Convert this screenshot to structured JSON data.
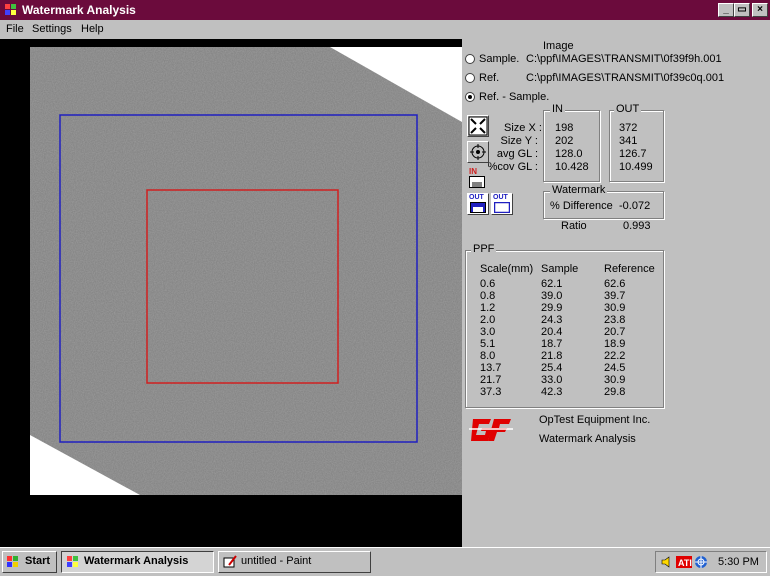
{
  "window": {
    "title": "Watermark Analysis",
    "title_bar_color": "#6b0b3c",
    "minimize_glyph": "_",
    "maximize_glyph": "▭",
    "close_glyph": "×"
  },
  "menu": {
    "file": "File",
    "settings": "Settings",
    "help": "Help"
  },
  "image_source": {
    "header": "Image",
    "sample_label": "Sample.",
    "sample_path": "C:\\ppf\\IMAGES\\TRANSMIT\\0f39f9h.001",
    "ref_label": "Ref.",
    "ref_path": "C:\\ppf\\IMAGES\\TRANSMIT\\0f39c0q.001",
    "ref_minus_sample_label": "Ref. - Sample.",
    "selected": "ref_minus_sample"
  },
  "stats": {
    "in_title": "IN",
    "out_title": "OUT",
    "rows": [
      {
        "label": "Size X :",
        "in": "198",
        "out": "372"
      },
      {
        "label": "Size Y :",
        "in": "202",
        "out": "341"
      },
      {
        "label": "avg GL :",
        "in": "128.0",
        "out": "126.7"
      },
      {
        "label": "%cov GL :",
        "in": "10.428",
        "out": "10.499"
      }
    ]
  },
  "tool_icons": {
    "in_label": "IN",
    "out_label": "OUT"
  },
  "watermark": {
    "title": "Watermark",
    "pct_diff_label": "% Difference",
    "pct_diff_value": "-0.072",
    "ratio_label": "Ratio",
    "ratio_value": "0.993"
  },
  "ppf": {
    "title": "PPF",
    "headers": [
      "Scale(mm)",
      "Sample",
      "Reference"
    ],
    "rows": [
      [
        "0.6",
        "62.1",
        "62.6"
      ],
      [
        "0.8",
        "39.0",
        "39.7"
      ],
      [
        "1.2",
        "29.9",
        "30.9"
      ],
      [
        "2.0",
        "24.3",
        "23.8"
      ],
      [
        "3.0",
        "20.4",
        "20.7"
      ],
      [
        "5.1",
        "18.7",
        "18.9"
      ],
      [
        "8.0",
        "21.8",
        "22.2"
      ],
      [
        "13.7",
        "25.4",
        "24.5"
      ],
      [
        "21.7",
        "33.0",
        "30.9"
      ],
      [
        "37.3",
        "42.3",
        "29.8"
      ]
    ]
  },
  "company": {
    "name": "OpTest Equipment Inc.",
    "product": "Watermark  Analysis",
    "logo_color": "#e00000"
  },
  "colors": {
    "out_roi": "#2020c0",
    "in_roi": "#d02020"
  },
  "taskbar": {
    "start_label": "Start",
    "tasks": [
      "Watermark Analysis",
      "untitled - Paint"
    ],
    "clock": "5:30 PM"
  }
}
